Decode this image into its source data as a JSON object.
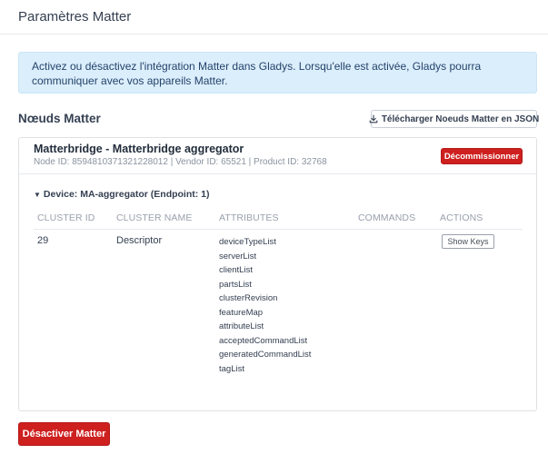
{
  "header": {
    "title": "Paramètres Matter"
  },
  "alert": {
    "text": "Activez ou désactivez l'intégration Matter dans Gladys. Lorsqu'elle est activée, Gladys pourra communiquer avec vos appareils Matter."
  },
  "nodes_section": {
    "title": "Nœuds Matter",
    "download_label": "Télécharger Noeuds Matter en JSON",
    "download_icon": "download-icon"
  },
  "node": {
    "name": "Matterbridge - Matterbridge aggregator",
    "meta": "Node ID: 8594810371321228012 | Vendor ID: 65521 | Product ID: 32768",
    "decommission_label": "Décommissionner",
    "device": {
      "title": "Device: MA-aggregator (Endpoint: 1)",
      "columns": [
        "CLUSTER ID",
        "CLUSTER NAME",
        "ATTRIBUTES",
        "COMMANDS",
        "ACTIONS"
      ],
      "rows": [
        {
          "cluster_id": "29",
          "cluster_name": "Descriptor",
          "attributes": [
            "deviceTypeList",
            "serverList",
            "clientList",
            "partsList",
            "clusterRevision",
            "featureMap",
            "attributeList",
            "acceptedCommandList",
            "generatedCommandList",
            "tagList"
          ],
          "commands": "",
          "action_label": "Show Keys"
        }
      ]
    }
  },
  "footer": {
    "deactivate_label": "Désactiver Matter"
  },
  "colors": {
    "danger": "#cd201f",
    "info_bg": "#dbeefb",
    "info_text": "#24436b"
  }
}
